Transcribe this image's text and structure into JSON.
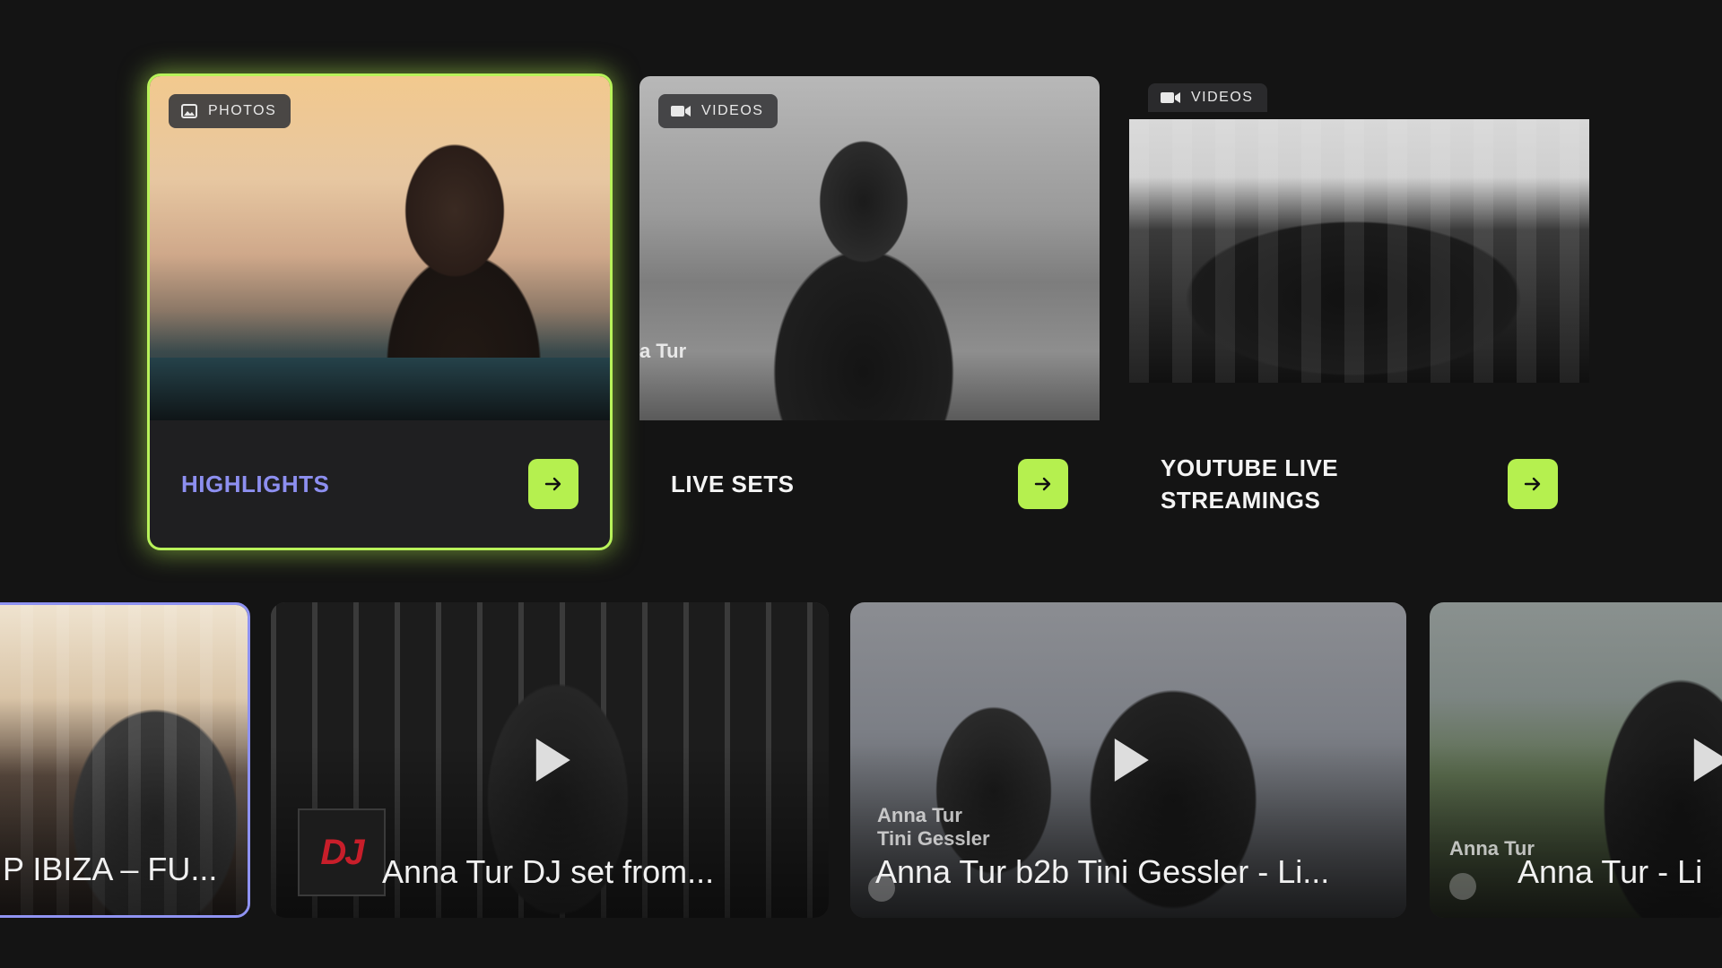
{
  "categories": [
    {
      "badge_icon": "image-icon",
      "badge_label": "PHOTOS",
      "title": "HIGHLIGHTS",
      "focused": true
    },
    {
      "badge_icon": "video-camera-icon",
      "badge_label": "VIDEOS",
      "title": "LIVE SETS",
      "overlay_text": "a Tur",
      "focused": false
    },
    {
      "badge_icon": "video-camera-icon",
      "badge_label": "VIDEOS",
      "title": "YOUTUBE LIVE STREAMINGS",
      "focused": false
    }
  ],
  "videos": [
    {
      "title": "P IBIZA – FU..."
    },
    {
      "title": "Anna Tur DJ set from...",
      "logo_text": "DJ"
    },
    {
      "title": "Anna Tur b2b Tini Gessler - Li...",
      "overlay_line1": "Anna Tur",
      "overlay_line2": "Tini Gessler"
    },
    {
      "title": "Anna Tur - Li",
      "overlay_line1": "Anna Tur"
    }
  ],
  "colors": {
    "background": "#141414",
    "accent_green": "#b5f04f",
    "focus_title": "#8d8ff0",
    "focus_border": "#8f93f2"
  }
}
